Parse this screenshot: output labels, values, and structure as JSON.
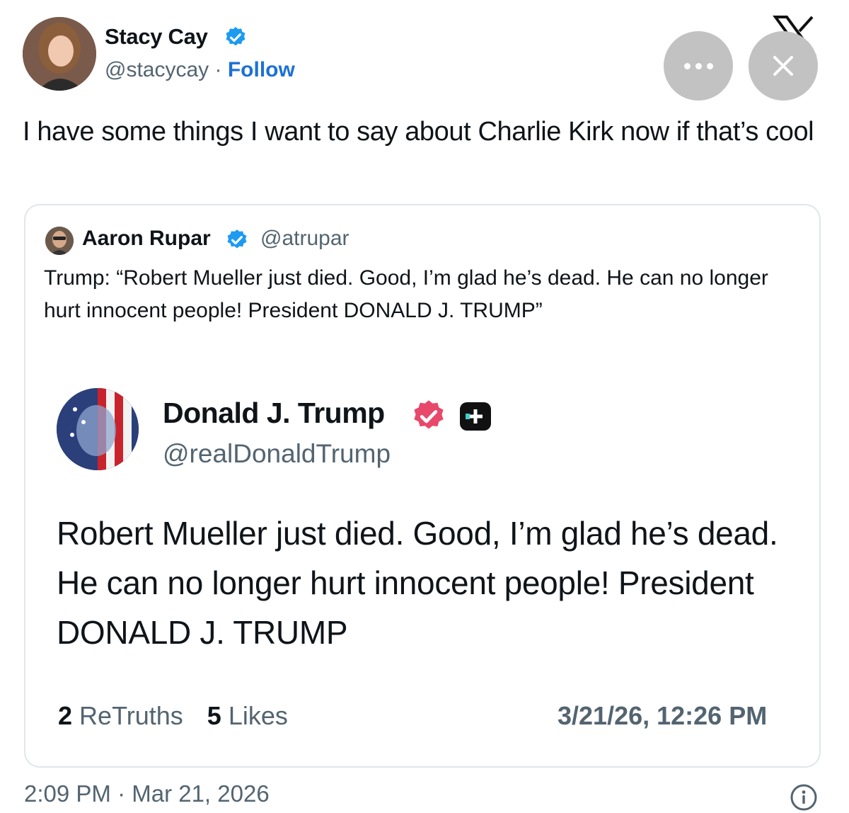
{
  "tweet": {
    "author_name": "Stacy Cay",
    "author_handle": "@stacycay",
    "separator": " · ",
    "follow_label": "Follow",
    "text": "I have some things I want to say about Charlie Kirk now if that’s cool",
    "timestamp": "2:09 PM · Mar 21, 2026"
  },
  "quote": {
    "author_name": "Aaron Rupar",
    "author_handle": "@atrupar",
    "text": "Trump: “Robert Mueller just died. Good, I’m glad he’s dead. He can no longer hurt innocent people! President DONALD J. TRUMP”"
  },
  "truth_post": {
    "author_name": "Donald J. Trump",
    "author_handle": "@realDonaldTrump",
    "text": "Robert Mueller just died. Good, I’m glad he’s dead. He can no longer hurt innocent people! President DONALD J. TRUMP",
    "retruths_count": "2",
    "retruths_label": "ReTruths",
    "likes_count": "5",
    "likes_label": "Likes",
    "date": "3/21/26, 12:26 PM"
  },
  "icons": {
    "verified": "verified-badge-icon",
    "truth_verified": "truth-verified-badge-icon",
    "more": "more-icon",
    "close": "close-icon",
    "x_logo": "x-logo-icon",
    "info": "info-icon"
  },
  "colors": {
    "accent_blue": "#1d9bf0",
    "follow_blue": "#1d70d6",
    "truth_badge": "#e8486a",
    "muted_text": "#536471",
    "button_grey": "#c2c2c2"
  }
}
